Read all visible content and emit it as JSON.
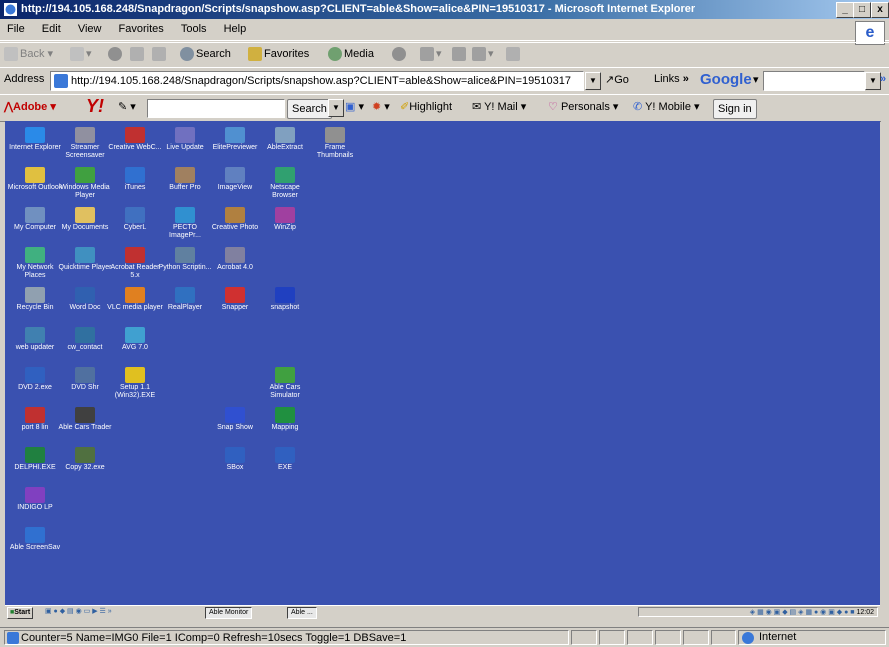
{
  "window": {
    "title": "http://194.105.168.248/Snapdragon/Scripts/snapshow.asp?CLIENT=able&Show=alice&PIN=19510317 - Microsoft Internet Explorer",
    "min_label": "_",
    "max_label": "□",
    "close_label": "x"
  },
  "menu": [
    "File",
    "Edit",
    "View",
    "Favorites",
    "Tools",
    "Help"
  ],
  "toolbar": {
    "back": "Back",
    "search": "Search",
    "favorites": "Favorites",
    "media": "Media"
  },
  "address": {
    "label": "Address",
    "url": "http://194.105.168.248/Snapdragon/Scripts/snapshow.asp?CLIENT=able&Show=alice&PIN=19510317",
    "go": "Go",
    "links": "Links",
    "chevron": "»",
    "google": "Google"
  },
  "yahoo": {
    "adobe": "Adobe",
    "y_logo": "Y!",
    "search_btn": "Search",
    "highlight": "Highlight",
    "mail": "Y! Mail",
    "personals": "Personals",
    "mobile": "Y! Mobile",
    "signin": "Sign in"
  },
  "desktop_icons": [
    {
      "label": "Internet Explorer",
      "color": "#2a8ae8"
    },
    {
      "label": "Streamer Screensaver",
      "color": "#9090a0"
    },
    {
      "label": "Creative WebC...",
      "color": "#c03030"
    },
    {
      "label": "Live Update",
      "color": "#7070c0"
    },
    {
      "label": "ElitePreviewer",
      "color": "#5090d0"
    },
    {
      "label": "AbleExtract",
      "color": "#80a0c0"
    },
    {
      "label": "Frame Thumbnails",
      "color": "#909090"
    },
    {
      "label": "Microsoft Outlook",
      "color": "#e0c040"
    },
    {
      "label": "Windows Media Player",
      "color": "#40a040"
    },
    {
      "label": "iTunes",
      "color": "#3070d0"
    },
    {
      "label": "Buffer Pro",
      "color": "#a08060"
    },
    {
      "label": "ImageView",
      "color": "#6080c0"
    },
    {
      "label": "Netscape Browser",
      "color": "#30a070"
    },
    {
      "label": "My Computer",
      "color": "#7090c0"
    },
    {
      "label": "My Documents",
      "color": "#e0c060"
    },
    {
      "label": "CyberL",
      "color": "#4070c0"
    },
    {
      "label": "PECTO ImagePr...",
      "color": "#3090d0"
    },
    {
      "label": "Creative Photo",
      "color": "#b08040"
    },
    {
      "label": "WinZip",
      "color": "#a040a0"
    },
    {
      "label": "My Network Places",
      "color": "#40b080"
    },
    {
      "label": "Quicktime Player",
      "color": "#4090c0"
    },
    {
      "label": "Acrobat Reader 5.x",
      "color": "#c03030"
    },
    {
      "label": "Python Scriptin...",
      "color": "#6080a0"
    },
    {
      "label": "Acrobat 4.0",
      "color": "#8080a0"
    },
    {
      "label": "Recycle Bin",
      "color": "#90a0b0"
    },
    {
      "label": "Word Doc",
      "color": "#3060b0"
    },
    {
      "label": "VLC media player",
      "color": "#e08020"
    },
    {
      "label": "RealPlayer",
      "color": "#3070c0"
    },
    {
      "label": "Snapper",
      "color": "#d03030"
    },
    {
      "label": "snapshot",
      "color": "#2040c0"
    },
    {
      "label": "web updater",
      "color": "#4080b0"
    },
    {
      "label": "cw_contact",
      "color": "#3070a0"
    },
    {
      "label": "AVG 7.0",
      "color": "#40a0d0"
    },
    {
      "label": "DVD 2.exe",
      "color": "#3060c0"
    },
    {
      "label": "DVD Shr",
      "color": "#5070a0"
    },
    {
      "label": "Setup 1.1 (Win32).EXE",
      "color": "#e0c020"
    },
    {
      "label": "Able Cars Simulator",
      "color": "#40a040"
    },
    {
      "label": "port 8 lin",
      "color": "#c03030"
    },
    {
      "label": "Able Cars Trader",
      "color": "#404040"
    },
    {
      "label": "Snap Show",
      "color": "#3050d0"
    },
    {
      "label": "Mapping",
      "color": "#209040"
    },
    {
      "label": "DELPHI.EXE",
      "color": "#208040"
    },
    {
      "label": "Copy 32.exe",
      "color": "#507040"
    },
    {
      "label": "SBox",
      "color": "#3060c0"
    },
    {
      "label": "EXE",
      "color": "#3060c0"
    },
    {
      "label": "INDIGO LP",
      "color": "#8040c0"
    },
    {
      "label": "Able ScreenSav",
      "color": "#3070d0"
    }
  ],
  "taskbar": {
    "start": "Start",
    "tasks": [
      "Able Monitor",
      "Able ..."
    ],
    "clock": "12:02"
  },
  "status": {
    "text": "Counter=5 Name=IMG0 File=1 IComp=0 Refresh=10secs Toggle=1 DBSave=1",
    "zone": "Internet"
  }
}
